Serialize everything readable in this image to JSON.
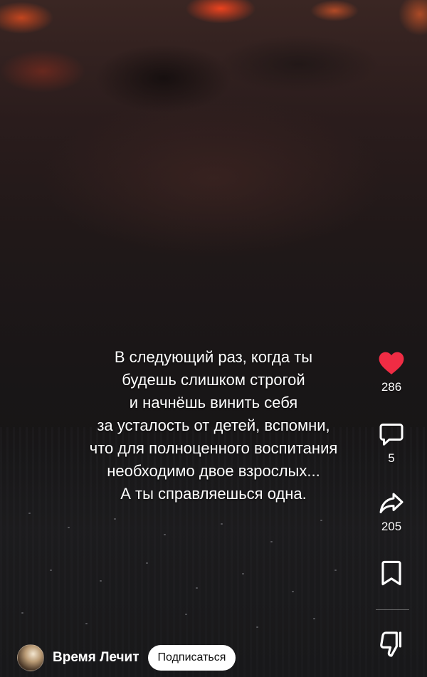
{
  "video": {
    "caption_lines": [
      "В следующий раз, когда ты",
      "будешь слишком строгой",
      "и начнёшь винить себя",
      "за усталость от детей, вспомни,",
      "что для полноценного воспитания",
      "необходимо двое взрослых...",
      "А ты справляешься одна."
    ]
  },
  "actions": {
    "like": {
      "icon": "heart-icon",
      "count": "286",
      "color": "#f02c44"
    },
    "comments": {
      "icon": "comment-icon",
      "count": "5"
    },
    "share": {
      "icon": "share-icon",
      "count": "205"
    },
    "save": {
      "icon": "bookmark-icon"
    },
    "dislike": {
      "icon": "thumbs-down-icon"
    }
  },
  "channel": {
    "name": "Время Лечит",
    "subscribe_label": "Подписаться"
  }
}
